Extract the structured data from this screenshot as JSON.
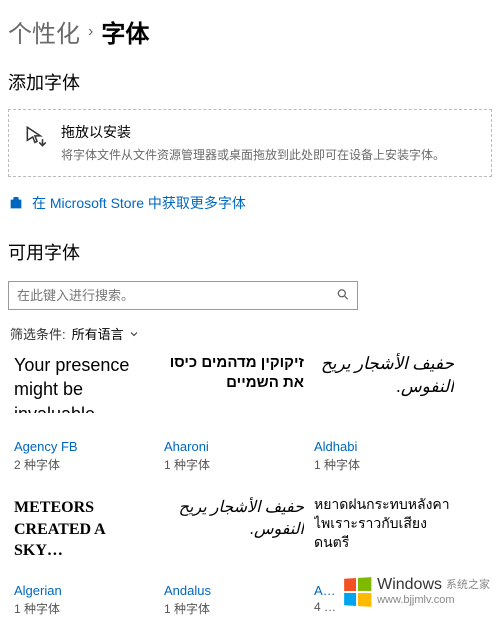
{
  "breadcrumb": {
    "parent": "个性化",
    "sep": "›",
    "current": "字体"
  },
  "add_section_title": "添加字体",
  "drop_zone": {
    "title": "拖放以安装",
    "subtitle": "将字体文件从文件资源管理器或桌面拖放到此处即可在设备上安装字体。"
  },
  "store_link": "在 Microsoft Store 中获取更多字体",
  "available_section_title": "可用字体",
  "search": {
    "placeholder": "在此键入进行搜索。"
  },
  "filter": {
    "label": "筛选条件:",
    "value": "所有语言"
  },
  "fonts": [
    {
      "sample": "Your presence might be invaluable.",
      "name": "Agency FB",
      "count": "2 种字体",
      "cls": "sample-agency"
    },
    {
      "sample": "זיקוקין מדהמים כיסו את השמיים",
      "name": "Aharoni",
      "count": "1 种字体",
      "cls": "sample-aharoni"
    },
    {
      "sample": "حفيف الأشجار يريح النفوس.",
      "name": "Aldhabi",
      "count": "1 种字体",
      "cls": "sample-aldhabi"
    },
    {
      "sample": "METEORS CREATED A SKY…",
      "name": "Algerian",
      "count": "1 种字体",
      "cls": "sample-algerian"
    },
    {
      "sample": "حفيف الأشجار يريح النفوس.",
      "name": "Andalus",
      "count": "1 种字体",
      "cls": "sample-andalus"
    },
    {
      "sample": "หยาดฝนกระทบหลังคาไพเราะราวกับเสียงดนตรี",
      "name": "A…",
      "count": "4 …",
      "cls": "sample-angsana"
    }
  ],
  "watermark": {
    "brand": "Windows",
    "sub": "系统之家",
    "site": "www.bjjmlv.com"
  }
}
